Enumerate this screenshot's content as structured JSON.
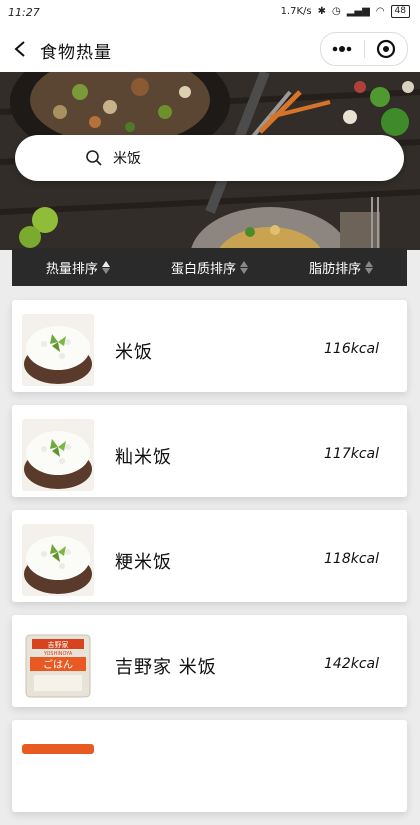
{
  "status_bar": {
    "time": "11:27",
    "speed": "1.7K/s",
    "battery": "48"
  },
  "nav": {
    "title": "食物热量"
  },
  "search": {
    "value": "米饭"
  },
  "sort": [
    {
      "label": "热量排序"
    },
    {
      "label": "蛋白质排序"
    },
    {
      "label": "脂肪排序"
    }
  ],
  "foods": [
    {
      "name": "米饭",
      "kcal": "116kcal",
      "image": "rice-bowl"
    },
    {
      "name": "籼米饭",
      "kcal": "117kcal",
      "image": "rice-bowl"
    },
    {
      "name": "粳米饭",
      "kcal": "118kcal",
      "image": "rice-bowl"
    },
    {
      "name": "吉野家 米饭",
      "kcal": "142kcal",
      "image": "packaged-rice",
      "package_text": [
        "吉野家",
        "YOSHINOYA",
        "ごはん"
      ]
    }
  ],
  "colors": {
    "sort_bar": "#2a2a2a",
    "hero_bg": "#2b2622",
    "background": "#ececec"
  }
}
